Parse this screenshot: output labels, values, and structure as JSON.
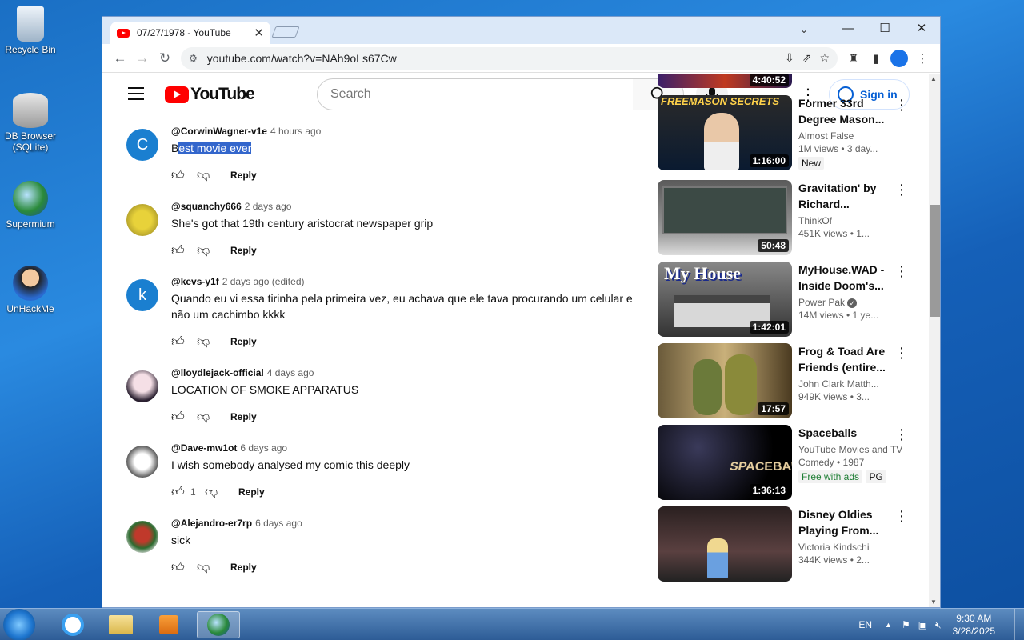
{
  "desktop": {
    "icons": [
      {
        "label": "Recycle Bin"
      },
      {
        "label": "DB Browser (SQLite)"
      },
      {
        "label": "Supermium"
      },
      {
        "label": "UnHackMe"
      }
    ]
  },
  "browser": {
    "tab_title": "07/27/1978 - YouTube",
    "url": "youtube.com/watch?v=NAh9oLs67Cw"
  },
  "youtube": {
    "logo_text": "YouTube",
    "search_placeholder": "Search",
    "signin_label": "Sign in"
  },
  "comments": [
    {
      "author": "@CorwinWagner-v1e",
      "time": "4 hours ago",
      "text_first": "B",
      "text_selected": "est movie ever",
      "likes": "",
      "reply": "Reply",
      "avatar_letter": "C",
      "avatar_color": "#1a7fd0"
    },
    {
      "author": "@squanchy666",
      "time": "2 days ago",
      "text": "She's got that 19th century aristocrat newspaper grip",
      "likes": "",
      "reply": "Reply"
    },
    {
      "author": "@kevs-y1f",
      "time": "2 days ago (edited)",
      "text": "Quando eu vi essa tirinha pela primeira vez, eu achava que ele tava procurando um celular e não um cachimbo kkkk",
      "likes": "",
      "reply": "Reply",
      "avatar_letter": "k",
      "avatar_color": "#1a7fd0"
    },
    {
      "author": "@lloydlejack-official",
      "time": "4 days ago",
      "text": "LOCATION OF SMOKE APPARATUS",
      "likes": "",
      "reply": "Reply"
    },
    {
      "author": "@Dave-mw1ot",
      "time": "6 days ago",
      "text": "I wish somebody analysed my comic this deeply",
      "likes": "1",
      "reply": "Reply"
    },
    {
      "author": "@Alejandro-er7rp",
      "time": "6 days ago",
      "text": "sick",
      "likes": "",
      "reply": "Reply"
    }
  ],
  "recommendations": [
    {
      "title": "",
      "duration": "4:40:52",
      "channel": "",
      "views": ""
    },
    {
      "title": "Former 33rd Degree Mason...",
      "duration": "1:16:00",
      "channel": "Almost False",
      "views": "1M views • 3 day...",
      "badge": "New",
      "thumb_text": "FREEMASON SECRETS"
    },
    {
      "title": "Gravitation' by Richard...",
      "duration": "50:48",
      "channel": "ThinkOf",
      "views": "451K views • 1..."
    },
    {
      "title": "MyHouse.WAD - Inside Doom's...",
      "duration": "1:42:01",
      "channel": "Power Pak",
      "views": "14M views • 1 ye...",
      "thumb_text": "My House"
    },
    {
      "title": "Frog & Toad Are Friends (entire...",
      "duration": "17:57",
      "channel": "John Clark Matth...",
      "views": "949K views • 3..."
    },
    {
      "title": "Spaceballs",
      "duration": "1:36:13",
      "channel": "YouTube Movies and TV",
      "views": "Comedy • 1987",
      "badge": "Free with ads",
      "badge2": "PG",
      "thumb_text": "SPACEBALLS"
    },
    {
      "title": "Disney Oldies Playing From...",
      "duration": "",
      "channel": "Victoria Kindschi",
      "views": "344K views • 2..."
    }
  ],
  "taskbar": {
    "lang": "EN",
    "time": "9:30 AM",
    "date": "3/28/2025"
  },
  "colors": {
    "youtube_red": "#ff0000",
    "link_blue": "#065fd4",
    "selection": "#3366cc"
  }
}
